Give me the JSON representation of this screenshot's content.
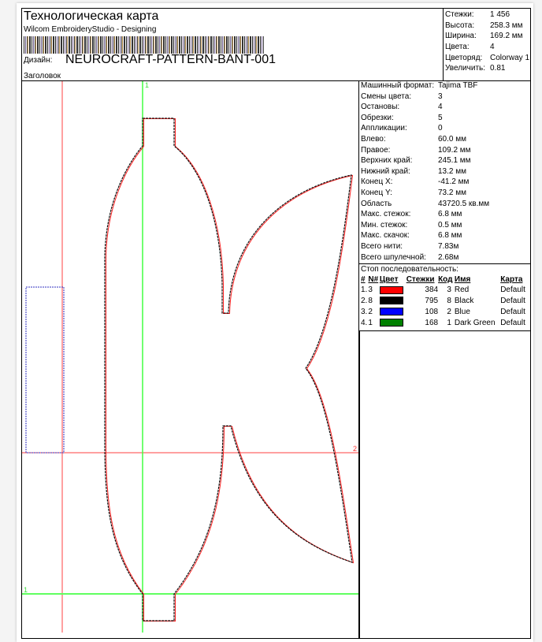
{
  "header": {
    "title": "Технологическая карта",
    "subtitle": "Wilcom EmbroideryStudio - Designing",
    "design_label": "Дизайн:",
    "design_name": "NEUROCRAFT-PATTERN-BANT-001",
    "heading_label": "Заголовок"
  },
  "summary": [
    {
      "k": "Стежки:",
      "v": "1 456"
    },
    {
      "k": "Высота:",
      "v": "258.3 мм"
    },
    {
      "k": "Ширина:",
      "v": "169.2 мм"
    },
    {
      "k": "Цвета:",
      "v": "4"
    },
    {
      "k": "Цветоряд:",
      "v": "Colorway 1"
    },
    {
      "k": "Увеличить:",
      "v": "0.81"
    }
  ],
  "details": [
    {
      "k": "Машинный формат:",
      "v": "Tajima TBF"
    },
    {
      "k": "Смены цвета:",
      "v": "3"
    },
    {
      "k": "Остановы:",
      "v": "4"
    },
    {
      "k": "Обрезки:",
      "v": "5"
    },
    {
      "k": "Аппликации:",
      "v": "0"
    },
    {
      "k": "Влево:",
      "v": "60.0 мм"
    },
    {
      "k": "Правое:",
      "v": "109.2 мм"
    },
    {
      "k": "Верхних край:",
      "v": "245.1 мм"
    },
    {
      "k": "Нижний край:",
      "v": "13.2 мм"
    },
    {
      "k": "Конец X:",
      "v": "-41.2 мм"
    },
    {
      "k": "Конец Y:",
      "v": "73.2 мм"
    },
    {
      "k": "Область",
      "v": "43720.5 кв.мм"
    },
    {
      "k": "Макс. стежок:",
      "v": "6.8 мм"
    },
    {
      "k": "Мин. стежок:",
      "v": "0.5 мм"
    },
    {
      "k": "Макс. скачок:",
      "v": "6.8 мм"
    },
    {
      "k": "Всего нити:",
      "v": "7.83м"
    },
    {
      "k": "Всего шпулечной:",
      "v": "2.68м"
    }
  ],
  "stop_sequence": {
    "title": "Стоп последовательность:",
    "columns": [
      "#",
      "N#",
      "Цвет",
      "Стежки",
      "Код",
      "Имя",
      "Карта"
    ],
    "rows": [
      {
        "idx": "1.",
        "n": "3",
        "color": "#ff0000",
        "stitches": "384",
        "code": "3",
        "name": "Red",
        "chart": "Default"
      },
      {
        "idx": "2.",
        "n": "8",
        "color": "#000000",
        "stitches": "795",
        "code": "8",
        "name": "Black",
        "chart": "Default"
      },
      {
        "idx": "3.",
        "n": "2",
        "color": "#0000ff",
        "stitches": "108",
        "code": "2",
        "name": "Blue",
        "chart": "Default"
      },
      {
        "idx": "4.",
        "n": "1",
        "color": "#008000",
        "stitches": "168",
        "code": "1",
        "name": "Dark Green",
        "chart": "Default"
      }
    ]
  },
  "guides": {
    "green_label_top": "1",
    "green_label_left": "1",
    "red_label_right": "2"
  }
}
